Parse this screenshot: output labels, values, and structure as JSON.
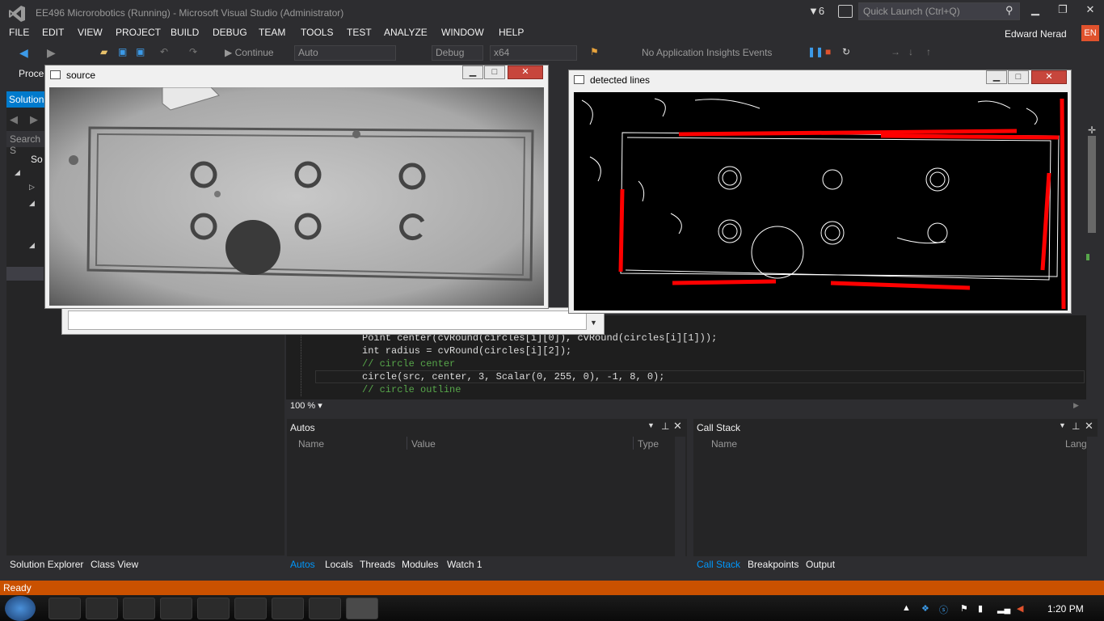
{
  "window": {
    "title": "EE496 Microrobotics (Running) - Microsoft Visual Studio (Administrator)",
    "notifications_count": "6",
    "quick_launch_placeholder": "Quick Launch (Ctrl+Q)"
  },
  "menu": [
    "FILE",
    "EDIT",
    "VIEW",
    "PROJECT",
    "BUILD",
    "DEBUG",
    "TEAM",
    "TOOLS",
    "TEST",
    "ANALYZE",
    "WINDOW",
    "HELP"
  ],
  "user": {
    "name": "Edward Nerad",
    "lang": "EN"
  },
  "toolbar": {
    "continue_label": "Continue",
    "config_combo": "Auto",
    "build_combo": "Debug",
    "platform_combo": "x64",
    "app_insights": "No Application Insights Events"
  },
  "left_panel": {
    "process_label": "Proce",
    "solution_tab": "Solution",
    "search_placeholder": "Search S",
    "tree_item": "So",
    "bottom_tabs": [
      {
        "label": "Solution Explorer",
        "active": true
      },
      {
        "label": "Class View",
        "active": false
      }
    ]
  },
  "source_window": {
    "title": "source"
  },
  "detected_window": {
    "title": "detected lines"
  },
  "editor": {
    "lines": [
      {
        "text": "Point center(cvRound(circles[i][0]), cvRound(circles[i][1]));",
        "kind": "code"
      },
      {
        "text": "int radius = cvRound(circles[i][2]);",
        "kind": "code"
      },
      {
        "text": "// circle center",
        "kind": "comment"
      },
      {
        "text": "circle(src, center, 3, Scalar(0, 255, 0), -1, 8, 0);",
        "kind": "code"
      },
      {
        "text": "// circle outline",
        "kind": "comment"
      }
    ],
    "zoom": "100 %"
  },
  "autos": {
    "title": "Autos",
    "columns": [
      "Name",
      "Value",
      "Type"
    ],
    "tabs": [
      {
        "label": "Autos",
        "active": true
      },
      {
        "label": "Locals",
        "active": false
      },
      {
        "label": "Threads",
        "active": false
      },
      {
        "label": "Modules",
        "active": false
      },
      {
        "label": "Watch 1",
        "active": false
      }
    ]
  },
  "callstack": {
    "title": "Call Stack",
    "columns": [
      "Name",
      "Lang"
    ],
    "tabs": [
      {
        "label": "Call Stack",
        "active": true
      },
      {
        "label": "Breakpoints",
        "active": false
      },
      {
        "label": "Output",
        "active": false
      }
    ]
  },
  "status": {
    "text": "Ready"
  },
  "taskbar": {
    "clock": "1:20 PM"
  },
  "colors": {
    "accent": "#007acc",
    "status": "#ca5100",
    "detected_line": "#ff0000"
  }
}
